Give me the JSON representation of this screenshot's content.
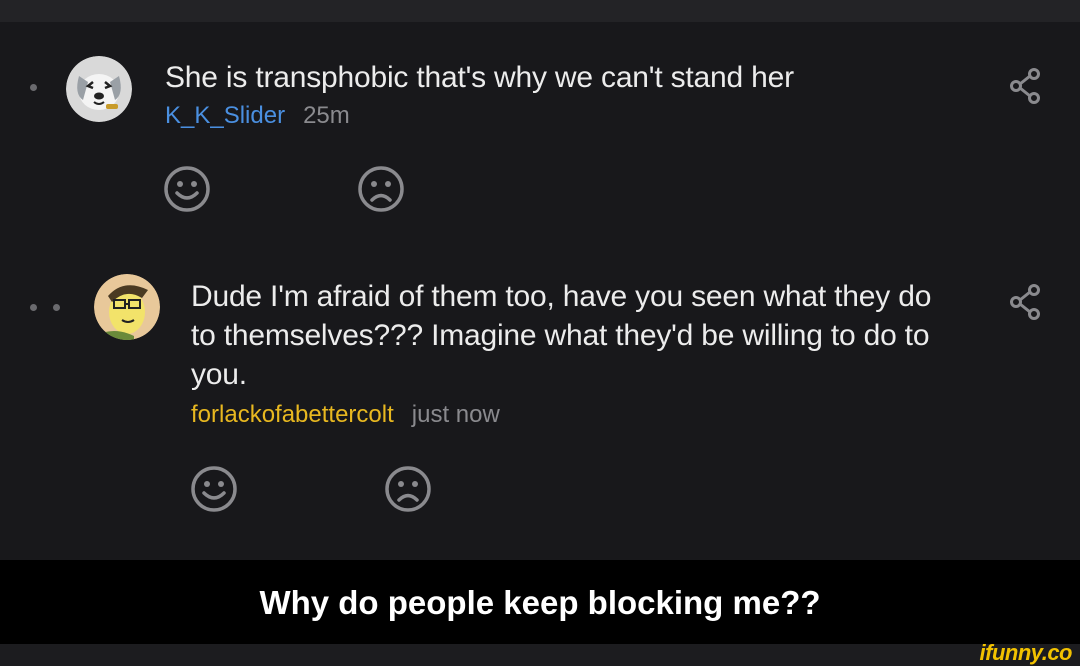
{
  "comments": [
    {
      "text": "She is transphobic that's why we can't stand her",
      "author": "K_K_Slider",
      "time": "25m",
      "avatar_icon": "dog-avatar-icon",
      "author_color": "#4a8fe0"
    },
    {
      "text": "Dude I'm afraid of them too, have you seen what they do to themselves??? Imagine what they'd be willing to do to you.",
      "author": "forlackofabettercolt",
      "time": "just now",
      "avatar_icon": "cartoon-pony-avatar-icon",
      "author_color": "#e8b820"
    }
  ],
  "caption": "Why do people keep blocking me??",
  "watermark": "ifunny.co",
  "icons": {
    "like": "smile-icon",
    "dislike": "frown-icon",
    "share": "share-icon"
  },
  "colors": {
    "background": "#18181b",
    "text": "#ececec",
    "timestamp": "#8a8a8e",
    "watermark": "#f2c200"
  }
}
